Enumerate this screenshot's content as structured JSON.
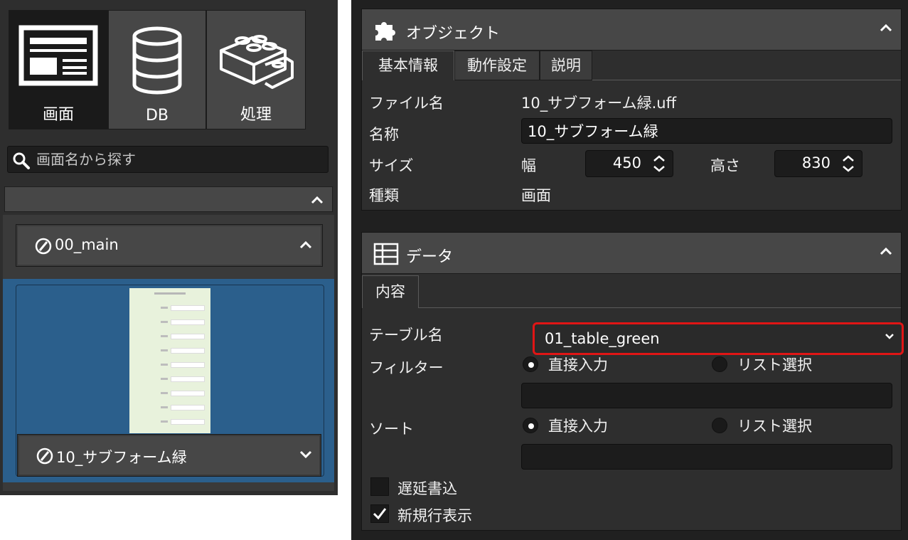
{
  "left": {
    "modes": [
      {
        "label": "画面",
        "icon": "screen-layout-icon"
      },
      {
        "label": "DB",
        "icon": "database-icon"
      },
      {
        "label": "処理",
        "icon": "blocks-icon"
      }
    ],
    "search": {
      "placeholder": "画面名から探す"
    },
    "group_header": {
      "label": ""
    },
    "items": [
      {
        "name": "00_main",
        "expanded": true
      },
      {
        "name": "10_サブフォーム緑",
        "selected": true
      }
    ]
  },
  "object_section": {
    "title": "オブジェクト",
    "tabs": [
      "基本情報",
      "動作設定",
      "説明"
    ],
    "active_tab": "基本情報",
    "file_name_label": "ファイル名",
    "file_name_value": "10_サブフォーム緑.uff",
    "name_label": "名称",
    "name_value": "10_サブフォーム緑",
    "size_label": "サイズ",
    "width_label": "幅",
    "width_value": "450",
    "height_label": "高さ",
    "height_value": "830",
    "kind_label": "種類",
    "kind_value": "画面"
  },
  "data_section": {
    "title": "データ",
    "tabs": [
      "内容"
    ],
    "table_label": "テーブル名",
    "table_value": "01_table_green",
    "filter_label": "フィルター",
    "filter_options": [
      "直接入力",
      "リスト選択"
    ],
    "filter_selected": "直接入力",
    "filter_value": "",
    "sort_label": "ソート",
    "sort_options": [
      "直接入力",
      "リスト選択"
    ],
    "sort_selected": "直接入力",
    "sort_value": "",
    "delayed_write_label": "遅延書込",
    "delayed_write_checked": false,
    "show_new_row_label": "新規行表示",
    "show_new_row_checked": true
  },
  "colors": {
    "highlight": "#e01515",
    "selection": "#2b5f8c",
    "panel": "#2e2e2e"
  }
}
